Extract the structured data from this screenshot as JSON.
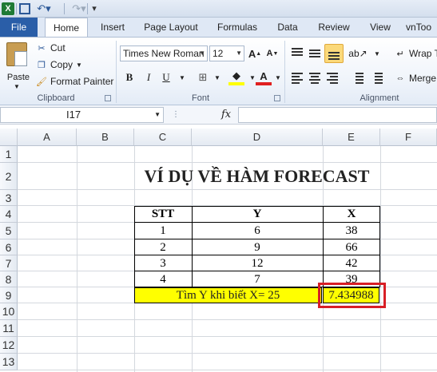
{
  "app": {
    "colors": {
      "file_tab": "#2a5ea8",
      "highlight": "#ffff00",
      "annotation": "#d81f26"
    },
    "quick_access": [
      "excel-icon",
      "save-icon",
      "undo-icon",
      "redo-icon",
      "customize-icon"
    ]
  },
  "tabs": [
    "File",
    "Home",
    "Insert",
    "Page Layout",
    "Formulas",
    "Data",
    "Review",
    "View",
    "vnToo"
  ],
  "ribbon": {
    "clipboard": {
      "paste": "Paste",
      "cut": "Cut",
      "copy": "Copy",
      "format_painter": "Format Painter",
      "label": "Clipboard"
    },
    "font": {
      "name": "Times New Roman",
      "size": "12",
      "bold": "B",
      "italic": "I",
      "underline": "U",
      "label": "Font"
    },
    "alignment": {
      "wrap": "Wrap T",
      "merge": "Merge",
      "label": "Alignment"
    }
  },
  "formula_bar": {
    "name_box": "I17",
    "fx": "fx",
    "value": ""
  },
  "sheet": {
    "columns": [
      "A",
      "B",
      "C",
      "D",
      "E",
      "F"
    ],
    "rows": [
      "1",
      "2",
      "3",
      "4",
      "5",
      "6",
      "7",
      "8",
      "9",
      "10",
      "11",
      "12",
      "13"
    ],
    "title": "VÍ DỤ VỀ HÀM FORECAST",
    "table": {
      "headers": [
        "STT",
        "Y",
        "X"
      ],
      "rows": [
        [
          "1",
          "6",
          "38"
        ],
        [
          "2",
          "9",
          "66"
        ],
        [
          "3",
          "12",
          "42"
        ],
        [
          "4",
          "7",
          "39"
        ]
      ]
    },
    "query_label": "Tìm Y khi biết X= 25",
    "result": "7.434988"
  }
}
